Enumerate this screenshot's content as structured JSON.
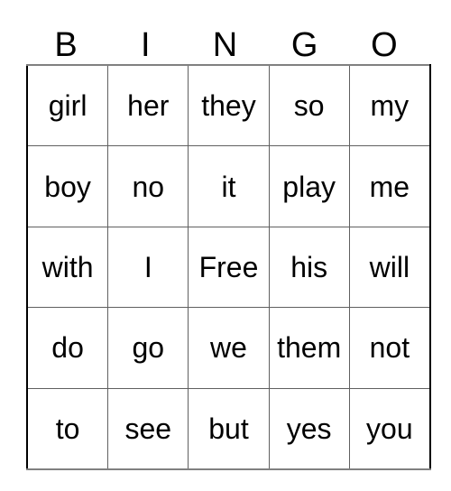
{
  "card": {
    "title": "BINGO",
    "headers": [
      "B",
      "I",
      "N",
      "G",
      "O"
    ],
    "free_space_label": "Free",
    "text_color": "#000000",
    "background_color": "#ffffff",
    "border_color": "#606060",
    "rows": [
      {
        "cells": [
          "girl",
          "her",
          "they",
          "so",
          "my"
        ]
      },
      {
        "cells": [
          "boy",
          "no",
          "it",
          "play",
          "me"
        ]
      },
      {
        "cells": [
          "with",
          "I",
          "Free",
          "his",
          "will"
        ]
      },
      {
        "cells": [
          "do",
          "go",
          "we",
          "them",
          "not"
        ]
      },
      {
        "cells": [
          "to",
          "see",
          "but",
          "yes",
          "you"
        ]
      }
    ]
  }
}
